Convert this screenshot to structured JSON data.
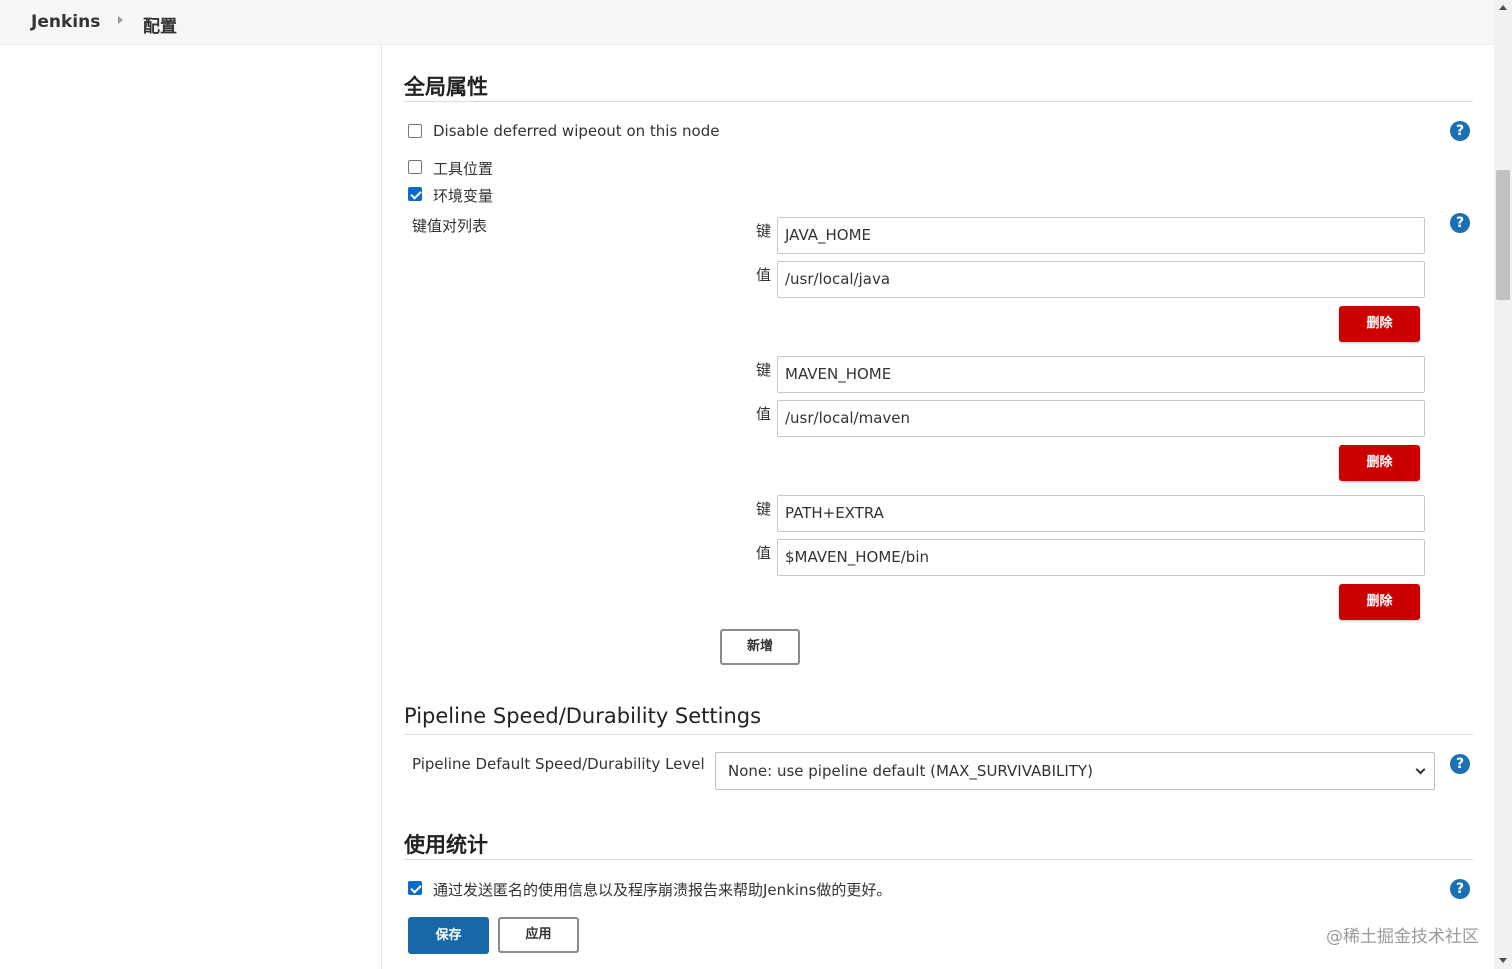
{
  "breadcrumb": {
    "app": "Jenkins",
    "page": "配置"
  },
  "global_properties": {
    "title": "全局属性",
    "disable_wipeout": {
      "label": "Disable deferred wipeout on this node",
      "checked": false
    },
    "tool_locations": {
      "label": "工具位置",
      "checked": false
    },
    "env_vars": {
      "label": "环境变量",
      "checked": true,
      "list_label": "键值对列表",
      "key_label": "键",
      "value_label": "值",
      "delete_label": "删除",
      "add_label": "新增",
      "entries": [
        {
          "key": "JAVA_HOME",
          "value": "/usr/local/java"
        },
        {
          "key": "MAVEN_HOME",
          "value": "/usr/local/maven"
        },
        {
          "key": "PATH+EXTRA",
          "value": "$MAVEN_HOME/bin"
        }
      ]
    }
  },
  "pipeline": {
    "title": "Pipeline Speed/Durability Settings",
    "level_label": "Pipeline Default Speed/Durability Level",
    "level_value": "None: use pipeline default (MAX_SURVIVABILITY)"
  },
  "usage": {
    "title": "使用统计",
    "opt_in": {
      "label": "通过发送匿名的使用信息以及程序崩溃报告来帮助Jenkins做的更好。",
      "checked": true
    }
  },
  "actions": {
    "save_label": "保存",
    "apply_label": "应用"
  },
  "help_glyph": "?",
  "watermark": "@稀土掘金技术社区",
  "colors": {
    "primary": "#1868a9",
    "danger": "#cc0000",
    "help": "#1a6fb5"
  }
}
